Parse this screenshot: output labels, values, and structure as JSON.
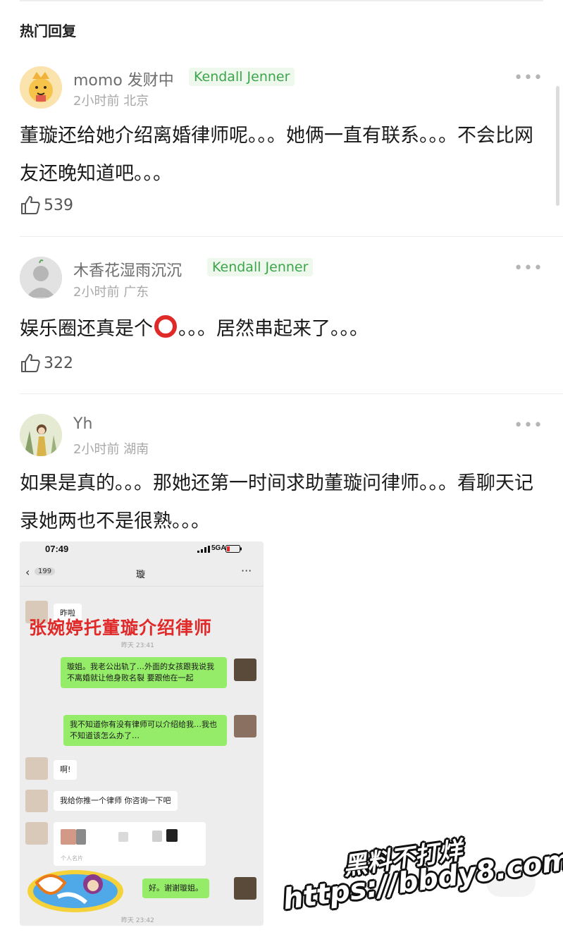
{
  "section_title": "热门回复",
  "comments": [
    {
      "username": "momo 发财中",
      "badge": "Kendall Jenner",
      "time": "2小时前",
      "location": "北京",
      "text": "董璇还给她介绍离婚律师呢。。。她俩一直有联系。。。不会比网友还晚知道吧。。。",
      "likes": "539"
    },
    {
      "username": "木香花湿雨沉沉",
      "badge": "Kendall Jenner",
      "time": "2小时前",
      "location": "广东",
      "text_before": "娱乐圈还真是个",
      "text_after": "。。。居然串起来了。。。",
      "likes": "322"
    },
    {
      "username": "Yh",
      "time": "2小时前",
      "location": "湖南",
      "text": "如果是真的。。。那她还第一时间求助董璇问律师。。。看聊天记录她两也不是很熟。。。"
    }
  ],
  "more_glyph": "•••",
  "chat_screenshot": {
    "status_time": "07:49",
    "status_network": "5GA",
    "back_count": "199",
    "title": "璇",
    "overlay_caption": "张婉婷托董璇介绍律师",
    "messages": [
      {
        "side": "in",
        "text": "昨啦"
      },
      {
        "side": "ts",
        "text": "昨天 23:41"
      },
      {
        "side": "out",
        "text": "璇姐。我老公出轨了…外面的女孩跟我说我不离婚就让他身败名裂 要跟他在一起"
      },
      {
        "side": "out",
        "text": "我不知道你有没有律师可以介绍给我…我也不知道该怎么办了…"
      },
      {
        "side": "in",
        "text": "啊!"
      },
      {
        "side": "in",
        "text": "我给你推一个律师 你咨询一下吧"
      },
      {
        "side": "card",
        "text": "个人名片"
      },
      {
        "side": "out",
        "text": "好。谢谢璇姐。"
      },
      {
        "side": "ts",
        "text": "昨天 23:42"
      }
    ]
  },
  "watermark": {
    "line1": "黑料不打烊",
    "line2": "https://bbdy8.com"
  },
  "colors": {
    "badge_text": "#3ca64c",
    "badge_bg": "#eef8ec",
    "bubble_out": "#95ec69",
    "emoji_ring": "#e02a2a"
  }
}
